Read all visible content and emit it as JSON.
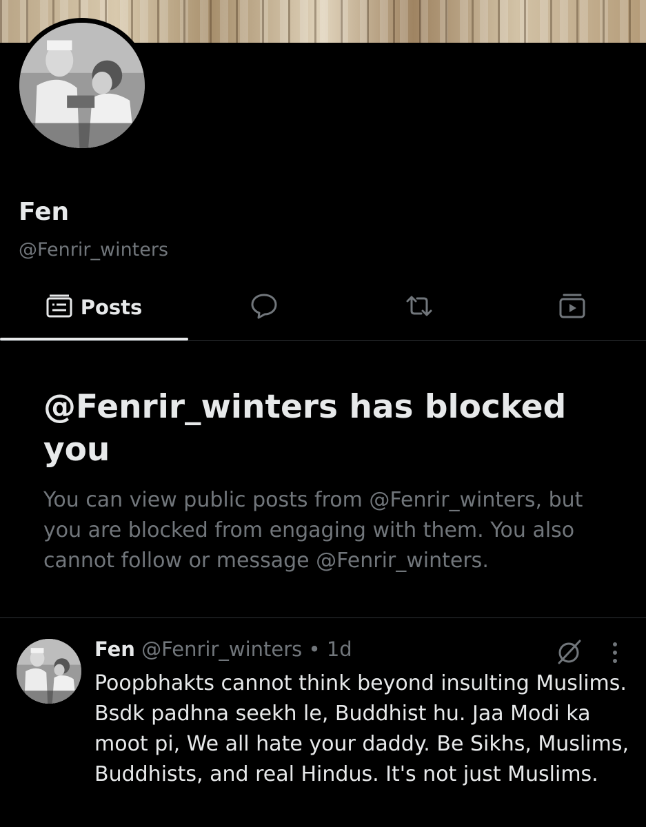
{
  "profile": {
    "name": "Fen",
    "handle": "@Fenrir_winters"
  },
  "tabs": [
    {
      "label": "Posts",
      "icon": "posts-icon",
      "active": true
    },
    {
      "icon": "replies-icon"
    },
    {
      "icon": "reposts-icon"
    },
    {
      "icon": "media-icon"
    }
  ],
  "blocked": {
    "title": "@Fenrir_winters has blocked you",
    "description": "You can view public posts from @Fenrir_winters, but you are blocked from engaging with them. You also cannot follow or message @Fenrir_winters."
  },
  "post": {
    "name": "Fen",
    "handle": "@Fenrir_winters",
    "separator": "•",
    "time": "1d",
    "text": "Poopbhakts cannot think beyond insulting Muslims. Bsdk padhna seekh le, Buddhist hu. Jaa Modi ka moot pi, We all hate your daddy. Be Sikhs, Muslims, Buddhists, and real Hindus. It's not just Muslims.",
    "actions": [
      "grok-icon",
      "more-icon"
    ]
  },
  "colors": {
    "background": "#000000",
    "primary_text": "#e7e9ea",
    "secondary_text": "#71767b",
    "divider": "#2f3336"
  }
}
